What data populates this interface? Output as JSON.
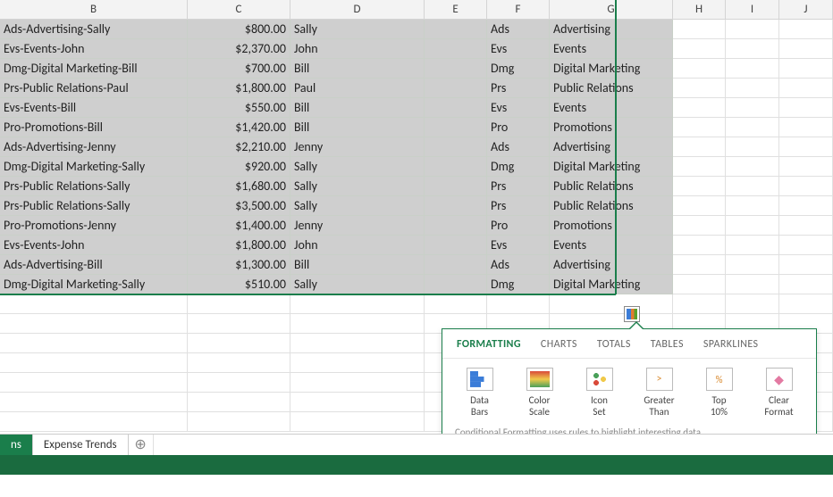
{
  "columns": [
    "B",
    "C",
    "D",
    "E",
    "F",
    "G",
    "H",
    "I",
    "J"
  ],
  "rows": [
    {
      "b": "Ads-Advertising-Sally",
      "c": "$800.00",
      "d": "Sally",
      "e": "",
      "f": "Ads",
      "g": "Advertising"
    },
    {
      "b": "Evs-Events-John",
      "c": "$2,370.00",
      "d": "John",
      "e": "",
      "f": "Evs",
      "g": "Events"
    },
    {
      "b": "Dmg-Digital Marketing-Bill",
      "c": "$700.00",
      "d": "Bill",
      "e": "",
      "f": "Dmg",
      "g": "Digital Marketing"
    },
    {
      "b": "Prs-Public Relations-Paul",
      "c": "$1,800.00",
      "d": "Paul",
      "e": "",
      "f": "Prs",
      "g": "Public Relations"
    },
    {
      "b": "Evs-Events-Bill",
      "c": "$550.00",
      "d": "Bill",
      "e": "",
      "f": "Evs",
      "g": "Events"
    },
    {
      "b": "Pro-Promotions-Bill",
      "c": "$1,420.00",
      "d": "Bill",
      "e": "",
      "f": "Pro",
      "g": "Promotions"
    },
    {
      "b": "Ads-Advertising-Jenny",
      "c": "$2,210.00",
      "d": "Jenny",
      "e": "",
      "f": "Ads",
      "g": "Advertising"
    },
    {
      "b": "Dmg-Digital Marketing-Sally",
      "c": "$920.00",
      "d": "Sally",
      "e": "",
      "f": "Dmg",
      "g": "Digital Marketing"
    },
    {
      "b": "Prs-Public Relations-Sally",
      "c": "$1,680.00",
      "d": "Sally",
      "e": "",
      "f": "Prs",
      "g": "Public Relations"
    },
    {
      "b": "Prs-Public Relations-Sally",
      "c": "$3,500.00",
      "d": "Sally",
      "e": "",
      "f": "Prs",
      "g": "Public Relations"
    },
    {
      "b": "Pro-Promotions-Jenny",
      "c": "$1,400.00",
      "d": "Jenny",
      "e": "",
      "f": "Pro",
      "g": "Promotions"
    },
    {
      "b": "Evs-Events-John",
      "c": "$1,800.00",
      "d": "John",
      "e": "",
      "f": "Evs",
      "g": "Events"
    },
    {
      "b": "Ads-Advertising-Bill",
      "c": "$1,300.00",
      "d": "Bill",
      "e": "",
      "f": "Ads",
      "g": "Advertising"
    },
    {
      "b": "Dmg-Digital Marketing-Sally",
      "c": "$510.00",
      "d": "Sally",
      "e": "",
      "f": "Dmg",
      "g": "Digital Marketing"
    }
  ],
  "popover": {
    "tabs": [
      "FORMATTING",
      "CHARTS",
      "TOTALS",
      "TABLES",
      "SPARKLINES"
    ],
    "active_tab": "FORMATTING",
    "items": [
      {
        "label": "Data Bars",
        "icon": "databars"
      },
      {
        "label": "Color Scale",
        "icon": "colorscale"
      },
      {
        "label": "Icon Set",
        "icon": "iconset"
      },
      {
        "label": "Greater Than",
        "icon": "greater",
        "glyph": ">"
      },
      {
        "label": "Top 10%",
        "icon": "top",
        "glyph": "%"
      },
      {
        "label": "Clear Format",
        "icon": "clear",
        "glyph": "◆"
      }
    ],
    "footer": "Conditional Formatting uses rules to highlight interesting data."
  },
  "sheet_tabs": {
    "partial": "ns",
    "tabs": [
      "Expense Trends"
    ],
    "add": "⊕"
  }
}
